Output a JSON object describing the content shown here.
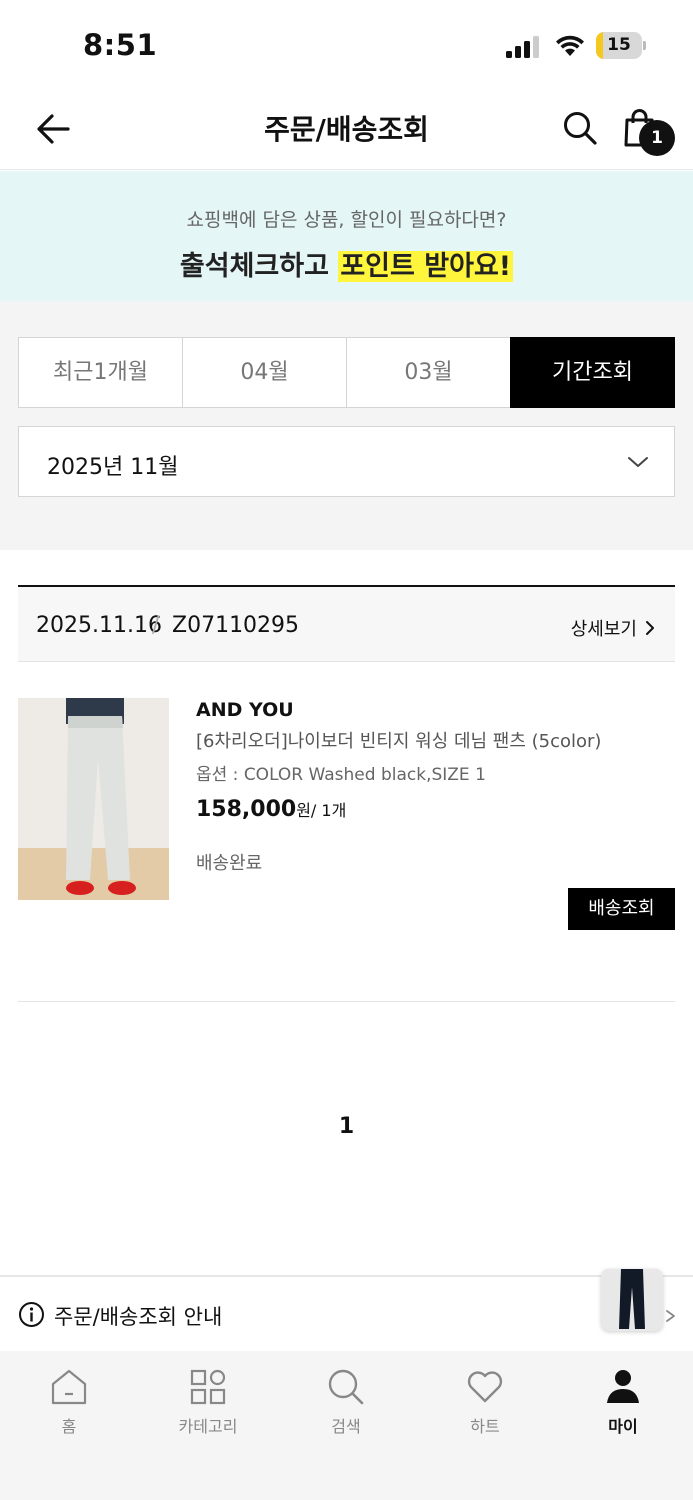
{
  "status_bar": {
    "time": "8:51",
    "battery": "15",
    "battery_fraction": 0.15
  },
  "header": {
    "title": "주문/배송조회",
    "cart_count": "1"
  },
  "banner": {
    "subtitle": "쇼핑백에 담은 상품, 할인이 필요하다면?",
    "title_plain": "출석체크하고 ",
    "title_highlight": "포인트 받아요!"
  },
  "period_tabs": [
    {
      "label": "최근1개월",
      "active": false
    },
    {
      "label": "04월",
      "active": false
    },
    {
      "label": "03월",
      "active": false
    },
    {
      "label": "기간조회",
      "active": true
    }
  ],
  "month_select": {
    "value": "2025년 11월"
  },
  "order": {
    "date": "2025.11.16",
    "separator": "/",
    "number": "Z07110295",
    "detail_label": "상세보기",
    "brand": "AND YOU",
    "product_name": "[6차리오더]나이보더 빈티지 워싱 데님 팬츠 (5color)",
    "option": "옵션 : COLOR Washed black,SIZE 1",
    "price": "158,000",
    "price_unit": "원/ 1개",
    "status": "배송완료",
    "track_label": "배송조회"
  },
  "pagination": {
    "current": "1"
  },
  "guide": {
    "label": "주문/배송조회 안내"
  },
  "bottom_nav": [
    {
      "label": "홈",
      "icon": "home-icon",
      "active": false
    },
    {
      "label": "카테고리",
      "icon": "category-icon",
      "active": false
    },
    {
      "label": "검색",
      "icon": "search-icon",
      "active": false
    },
    {
      "label": "하트",
      "icon": "heart-icon",
      "active": false
    },
    {
      "label": "마이",
      "icon": "person-icon",
      "active": true
    }
  ]
}
